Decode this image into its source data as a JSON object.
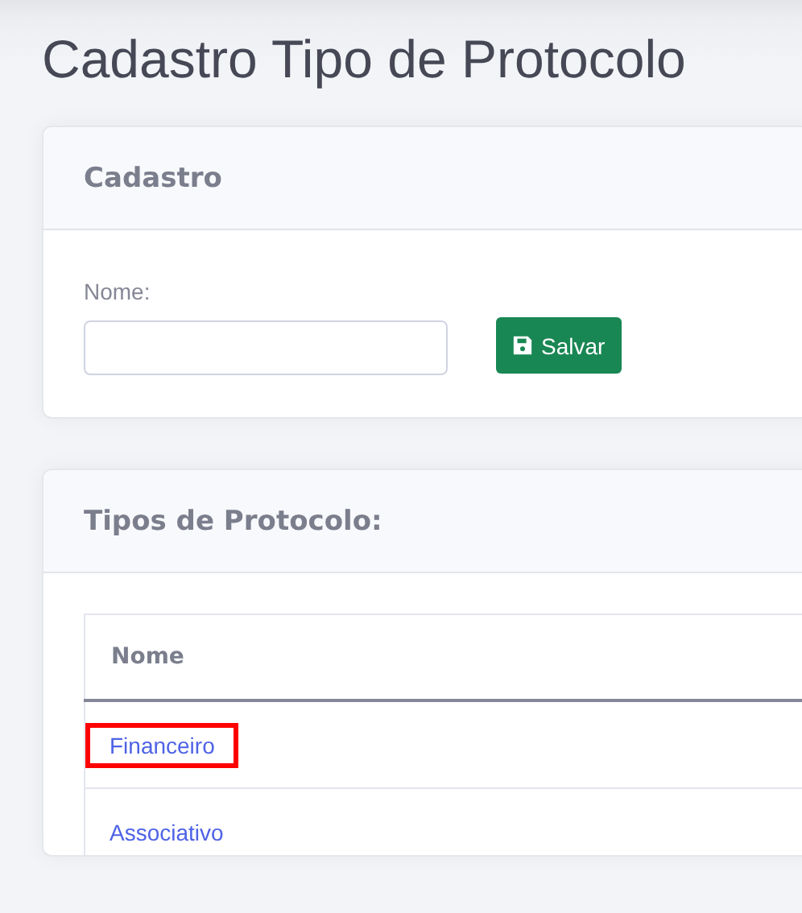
{
  "page_title": "Cadastro Tipo de Protocolo",
  "form_card": {
    "title": "Cadastro",
    "field": {
      "label": "Nome:"
    },
    "save_button": {
      "label": "Salvar"
    }
  },
  "list_card": {
    "title": "Tipos de Protocolo:",
    "table": {
      "columns": [
        "Nome"
      ],
      "rows": [
        {
          "name": "Financeiro",
          "highlighted": true
        },
        {
          "name": "Associativo",
          "highlighted": false
        }
      ]
    }
  }
}
